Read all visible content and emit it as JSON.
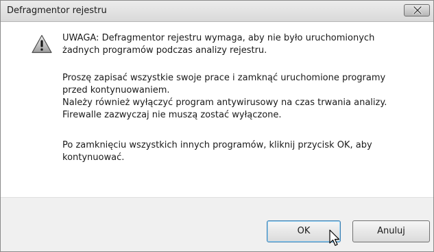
{
  "window": {
    "title": "Defragmentor rejestru",
    "close_icon": "close-x-icon"
  },
  "message": {
    "icon": "warning-triangle-icon",
    "paragraph1_line1": "UWAGA: Defragmentor rejestru wymaga, aby nie było uruchomionych",
    "paragraph1_line2": "żadnych programów podczas analizy rejestru.",
    "paragraph2_line1": "Proszę zapisać wszystkie swoje prace i zamknąć uruchomione programy",
    "paragraph2_line2": "przed kontynuowaniem.",
    "paragraph2_line3": "Należy również wyłączyć program antywirusowy na czas trwania analizy.",
    "paragraph2_line4": "Firewalle zazwyczaj nie muszą zostać wyłączone.",
    "paragraph3_line1": "Po zamknięciu wszystkich innych programów, kliknij przycisk OK, aby",
    "paragraph3_line2": "kontynuować."
  },
  "buttons": {
    "ok_label": "OK",
    "cancel_label": "Anuluj"
  },
  "cursor": {
    "icon": "mouse-pointer-icon"
  }
}
